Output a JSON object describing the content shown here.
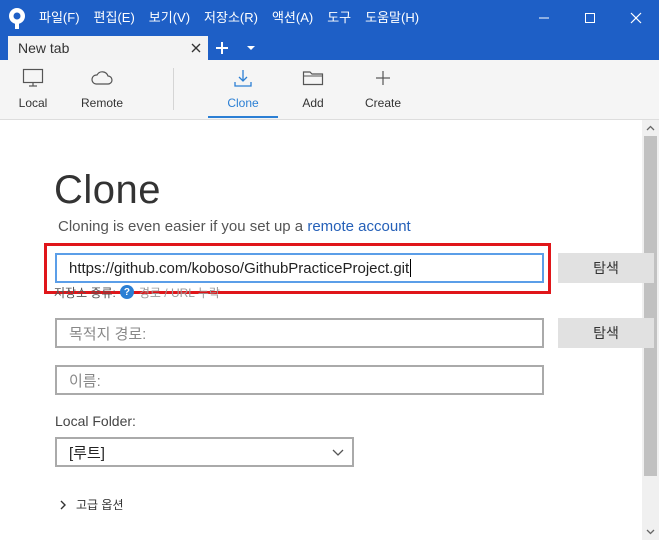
{
  "menu": {
    "items": [
      "파일(F)",
      "편집(E)",
      "보기(V)",
      "저장소(R)",
      "액션(A)",
      "도구",
      "도움말(H)"
    ]
  },
  "tabs": {
    "active_label": "New tab"
  },
  "toolbar": {
    "local": "Local",
    "remote": "Remote",
    "clone": "Clone",
    "add": "Add",
    "create": "Create"
  },
  "clone": {
    "title": "Clone",
    "subtitle_text": "Cloning is even easier if you set up a",
    "subtitle_link": "remote account",
    "url_value": "https://github.com/koboso/GithubPracticeProject.git",
    "browse_label": "탐색",
    "repo_type_label": "저장소 종류:",
    "repo_type_hint": "경로 / URL 누락",
    "destination_placeholder": "목적지 경로:",
    "name_placeholder": "이름:",
    "local_folder_label": "Local Folder:",
    "local_folder_value": "[루트]",
    "advanced_label": "고급 옵션"
  },
  "colors": {
    "titlebar": "#1e5fc6",
    "accent": "#2b7fd4",
    "highlight": "#e0161a"
  }
}
